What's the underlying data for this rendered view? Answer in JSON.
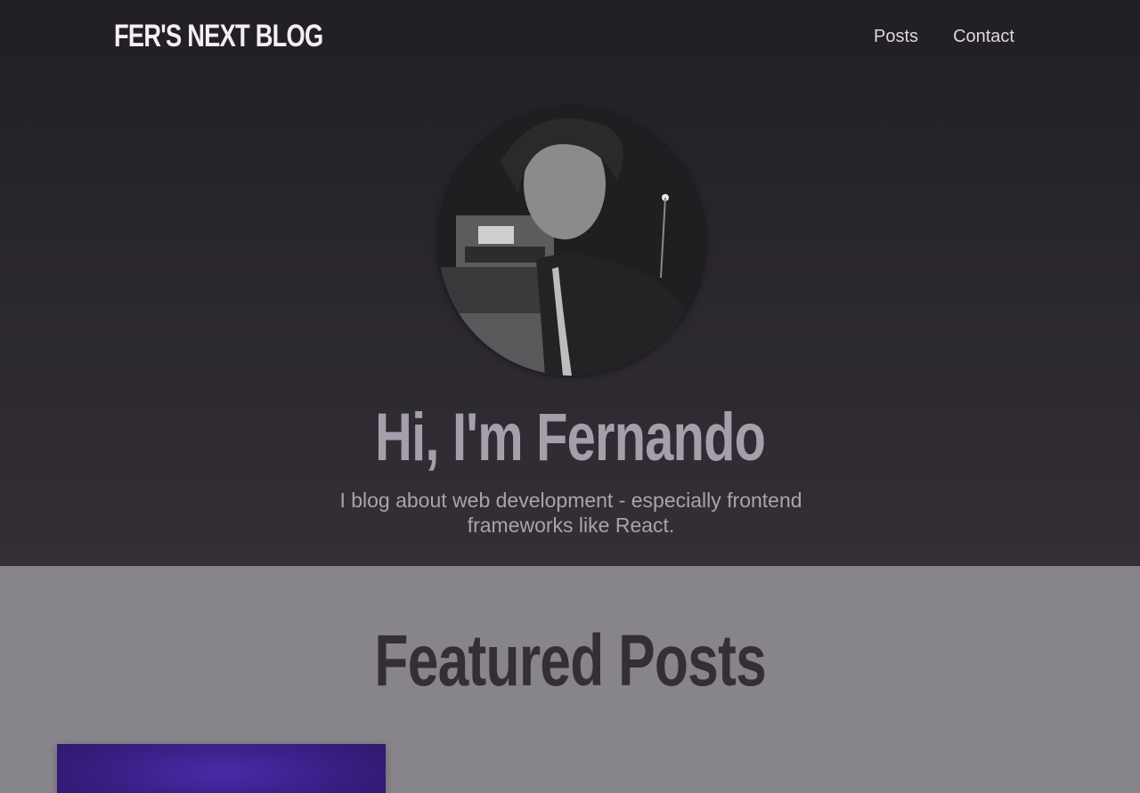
{
  "header": {
    "logo": "FER'S NEXT BLOG",
    "nav": [
      {
        "label": "Posts"
      },
      {
        "label": "Contact"
      }
    ]
  },
  "hero": {
    "title": "Hi, I'm Fernando",
    "subtitle": "I blog about web development - especially frontend frameworks like React."
  },
  "featured": {
    "title": "Featured Posts"
  },
  "colors": {
    "hero_bg_top": "#211f23",
    "hero_bg_bottom": "#342f36",
    "section_bg": "#87848b",
    "card_accent": "#4a2aa8"
  }
}
